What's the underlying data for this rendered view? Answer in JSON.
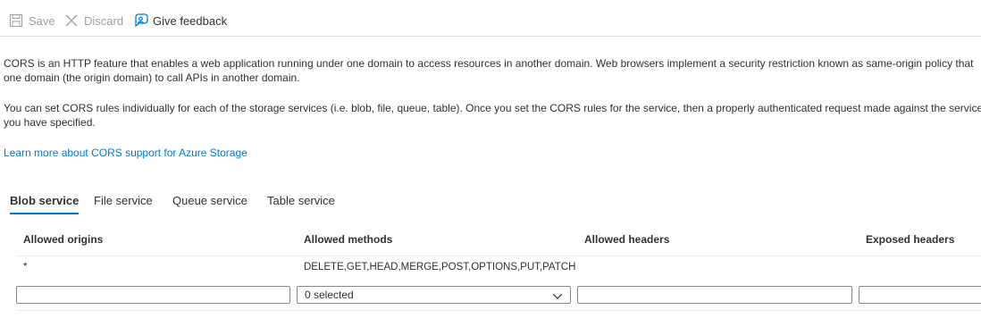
{
  "toolbar": {
    "save_label": "Save",
    "discard_label": "Discard",
    "feedback_label": "Give feedback"
  },
  "description": {
    "paragraph1_line1": "CORS is an HTTP feature that enables a web application running under one domain to access resources in another domain. Web browsers implement a security restriction known as same-origin policy that",
    "paragraph1_line2": "one domain (the origin domain) to call APIs in another domain.",
    "paragraph2_line1": "You can set CORS rules individually for each of the storage services (i.e. blob, file, queue, table). Once you set the CORS rules for the service, then a properly authenticated request made against the service f",
    "paragraph2_line2": "you have specified.",
    "learn_more": "Learn more about CORS support for Azure Storage"
  },
  "tabs": [
    {
      "label": "Blob service",
      "active": true
    },
    {
      "label": "File service",
      "active": false
    },
    {
      "label": "Queue service",
      "active": false
    },
    {
      "label": "Table service",
      "active": false
    }
  ],
  "table": {
    "headers": [
      "Allowed origins",
      "Allowed methods",
      "Allowed headers",
      "Exposed headers"
    ],
    "rows": [
      {
        "origins": "*",
        "methods": "DELETE,GET,HEAD,MERGE,POST,OPTIONS,PUT,PATCH",
        "headers": "",
        "exposed": ""
      }
    ],
    "new_row": {
      "origins_value": "",
      "methods_selected": "0 selected",
      "headers_value": "",
      "exposed_value": ""
    }
  },
  "colors": {
    "accent": "#0078d4",
    "text": "#323130",
    "disabled": "#a19f9d"
  }
}
